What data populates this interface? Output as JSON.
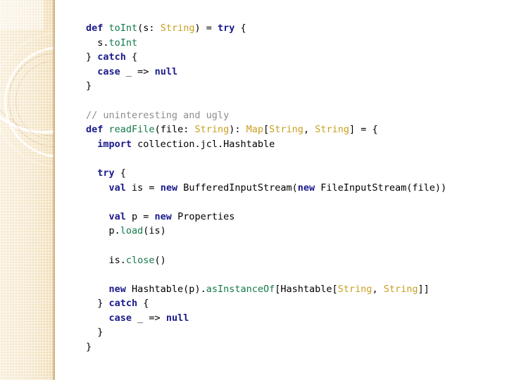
{
  "slide": {
    "background_color": "#ffffff",
    "sidebar": {
      "name": "decorative-sidebar",
      "base_color": "#f3e2c2",
      "edge_color": "#c6a26e",
      "accent_color": "#ffffff"
    },
    "code": {
      "language": "Scala",
      "font": "monospace",
      "colors": {
        "keyword": "#1a1a8c",
        "function": "#137a4a",
        "type": "#c8a020",
        "comment": "#8c8c8c",
        "plain": "#000000"
      },
      "lines": [
        {
          "id": "line-1",
          "text": "def toInt(s: String) = try {",
          "tokens": [
            {
              "t": "def",
              "c": "kw"
            },
            {
              "t": " ",
              "c": "plain"
            },
            {
              "t": "toInt",
              "c": "fn"
            },
            {
              "t": "(s: ",
              "c": "plain"
            },
            {
              "t": "String",
              "c": "type"
            },
            {
              "t": ") = ",
              "c": "plain"
            },
            {
              "t": "try",
              "c": "kw"
            },
            {
              "t": " {",
              "c": "plain"
            }
          ]
        },
        {
          "id": "line-2",
          "text": "  s.toInt",
          "tokens": [
            {
              "t": "  s.",
              "c": "plain"
            },
            {
              "t": "toInt",
              "c": "fn"
            }
          ]
        },
        {
          "id": "line-3",
          "text": "} catch {",
          "tokens": [
            {
              "t": "} ",
              "c": "plain"
            },
            {
              "t": "catch",
              "c": "kw"
            },
            {
              "t": " {",
              "c": "plain"
            }
          ]
        },
        {
          "id": "line-4",
          "text": "  case _ => null",
          "tokens": [
            {
              "t": "  ",
              "c": "plain"
            },
            {
              "t": "case",
              "c": "kw"
            },
            {
              "t": " _ => ",
              "c": "plain"
            },
            {
              "t": "null",
              "c": "kw"
            }
          ]
        },
        {
          "id": "line-5",
          "text": "}",
          "tokens": [
            {
              "t": "}",
              "c": "plain"
            }
          ]
        },
        {
          "id": "line-6",
          "text": "",
          "tokens": []
        },
        {
          "id": "line-7",
          "text": "// uninteresting and ugly",
          "tokens": [
            {
              "t": "// uninteresting and ugly",
              "c": "comment"
            }
          ]
        },
        {
          "id": "line-8",
          "text": "def readFile(file: String): Map[String, String] = {",
          "tokens": [
            {
              "t": "def",
              "c": "kw"
            },
            {
              "t": " ",
              "c": "plain"
            },
            {
              "t": "readFile",
              "c": "fn"
            },
            {
              "t": "(file: ",
              "c": "plain"
            },
            {
              "t": "String",
              "c": "type"
            },
            {
              "t": "): ",
              "c": "plain"
            },
            {
              "t": "Map",
              "c": "type"
            },
            {
              "t": "[",
              "c": "plain"
            },
            {
              "t": "String",
              "c": "type"
            },
            {
              "t": ", ",
              "c": "plain"
            },
            {
              "t": "String",
              "c": "type"
            },
            {
              "t": "] = {",
              "c": "plain"
            }
          ]
        },
        {
          "id": "line-9",
          "text": "  import collection.jcl.Hashtable",
          "tokens": [
            {
              "t": "  ",
              "c": "plain"
            },
            {
              "t": "import",
              "c": "kw"
            },
            {
              "t": " collection.jcl.Hashtable",
              "c": "plain"
            }
          ]
        },
        {
          "id": "line-10",
          "text": "",
          "tokens": []
        },
        {
          "id": "line-11",
          "text": "  try {",
          "tokens": [
            {
              "t": "  ",
              "c": "plain"
            },
            {
              "t": "try",
              "c": "kw"
            },
            {
              "t": " {",
              "c": "plain"
            }
          ]
        },
        {
          "id": "line-12",
          "text": "    val is = new BufferedInputStream(new FileInputStream(file))",
          "tokens": [
            {
              "t": "    ",
              "c": "plain"
            },
            {
              "t": "val",
              "c": "kw"
            },
            {
              "t": " is = ",
              "c": "plain"
            },
            {
              "t": "new",
              "c": "kw"
            },
            {
              "t": " BufferedInputStream(",
              "c": "plain"
            },
            {
              "t": "new",
              "c": "kw"
            },
            {
              "t": " FileInputStream(file))",
              "c": "plain"
            }
          ]
        },
        {
          "id": "line-13",
          "text": "",
          "tokens": []
        },
        {
          "id": "line-14",
          "text": "    val p = new Properties",
          "tokens": [
            {
              "t": "    ",
              "c": "plain"
            },
            {
              "t": "val",
              "c": "kw"
            },
            {
              "t": " p = ",
              "c": "plain"
            },
            {
              "t": "new",
              "c": "kw"
            },
            {
              "t": " Properties",
              "c": "plain"
            }
          ]
        },
        {
          "id": "line-15",
          "text": "    p.load(is)",
          "tokens": [
            {
              "t": "    p.",
              "c": "plain"
            },
            {
              "t": "load",
              "c": "fn"
            },
            {
              "t": "(is)",
              "c": "plain"
            }
          ]
        },
        {
          "id": "line-16",
          "text": "",
          "tokens": []
        },
        {
          "id": "line-17",
          "text": "    is.close()",
          "tokens": [
            {
              "t": "    is.",
              "c": "plain"
            },
            {
              "t": "close",
              "c": "fn"
            },
            {
              "t": "()",
              "c": "plain"
            }
          ]
        },
        {
          "id": "line-18",
          "text": "",
          "tokens": []
        },
        {
          "id": "line-19",
          "text": "    new Hashtable(p).asInstanceOf[Hashtable[String, String]]",
          "tokens": [
            {
              "t": "    ",
              "c": "plain"
            },
            {
              "t": "new",
              "c": "kw"
            },
            {
              "t": " Hashtable(p).",
              "c": "plain"
            },
            {
              "t": "asInstanceOf",
              "c": "fn"
            },
            {
              "t": "[Hashtable[",
              "c": "plain"
            },
            {
              "t": "String",
              "c": "type"
            },
            {
              "t": ", ",
              "c": "plain"
            },
            {
              "t": "String",
              "c": "type"
            },
            {
              "t": "]]",
              "c": "plain"
            }
          ]
        },
        {
          "id": "line-20",
          "text": "  } catch {",
          "tokens": [
            {
              "t": "  } ",
              "c": "plain"
            },
            {
              "t": "catch",
              "c": "kw"
            },
            {
              "t": " {",
              "c": "plain"
            }
          ]
        },
        {
          "id": "line-21",
          "text": "    case _ => null",
          "tokens": [
            {
              "t": "    ",
              "c": "plain"
            },
            {
              "t": "case",
              "c": "kw"
            },
            {
              "t": " _ => ",
              "c": "plain"
            },
            {
              "t": "null",
              "c": "kw"
            }
          ]
        },
        {
          "id": "line-22",
          "text": "  }",
          "tokens": [
            {
              "t": "  }",
              "c": "plain"
            }
          ]
        },
        {
          "id": "line-23",
          "text": "}",
          "tokens": [
            {
              "t": "}",
              "c": "plain"
            }
          ]
        }
      ]
    }
  }
}
